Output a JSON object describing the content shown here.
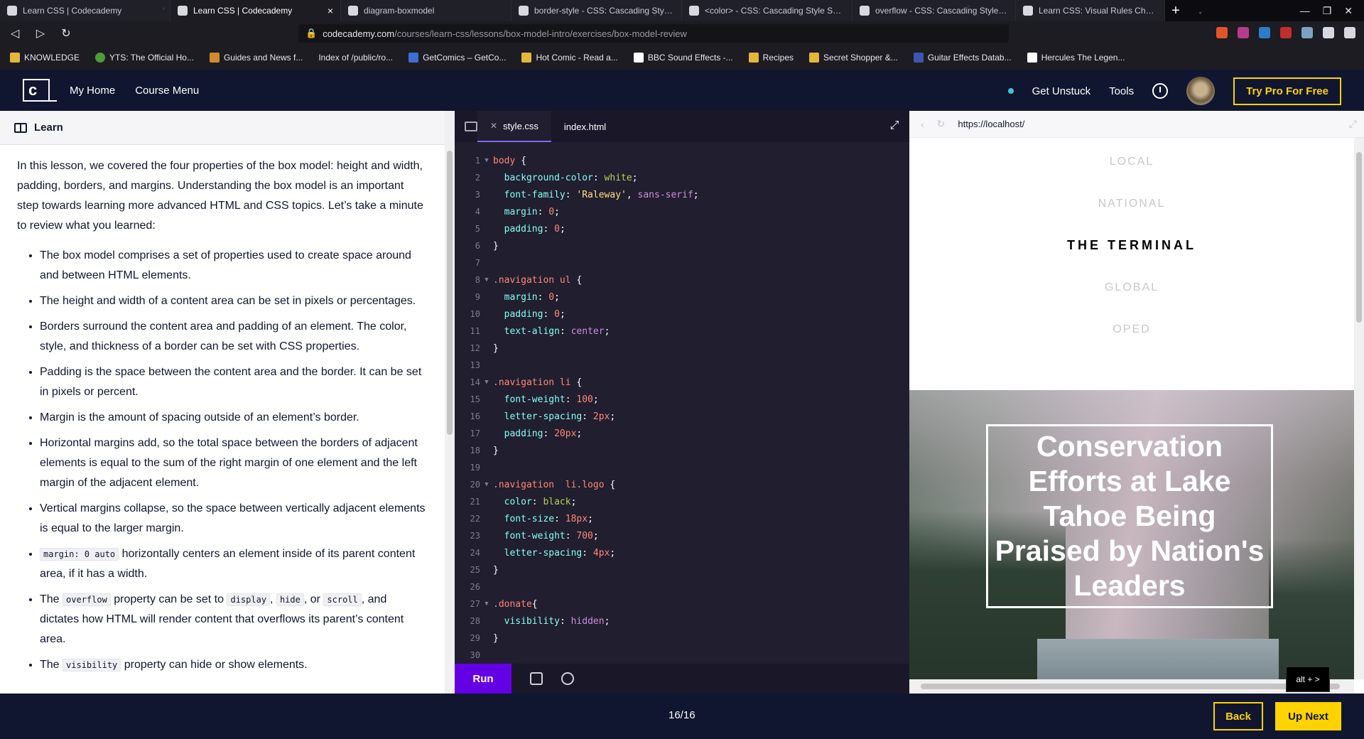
{
  "browser": {
    "tabs": [
      {
        "label": "Learn CSS | Codecademy",
        "active": false
      },
      {
        "label": "Learn CSS | Codecademy",
        "active": true
      },
      {
        "label": "diagram-boxmodel",
        "active": false
      },
      {
        "label": "border-style - CSS: Cascading Style S",
        "active": false
      },
      {
        "label": "<color> - CSS: Cascading Style Shee",
        "active": false
      },
      {
        "label": "overflow - CSS: Cascading Style Shee",
        "active": false
      },
      {
        "label": "Learn CSS: Visual Rules Cheatsheet",
        "active": false
      }
    ],
    "url_host": "codecademy.com",
    "url_path": "/courses/learn-css/lessons/box-model-intro/exercises/box-model-review",
    "bookmarks": [
      "KNOWLEDGE",
      "YTS: The Official Ho...",
      "Guides and News f...",
      "Index of /public/ro...",
      "GetComics – GetCo...",
      "Hot Comic - Read a...",
      "BBC Sound Effects -...",
      "Recipes",
      "Secret Shopper &...",
      "Guitar Effects Datab...",
      "Hercules The Legen..."
    ]
  },
  "header": {
    "logo": "c",
    "my_home": "My Home",
    "course_menu": "Course Menu",
    "get_unstuck": "Get Unstuck",
    "tools": "Tools",
    "try_pro": "Try Pro For Free"
  },
  "learn": {
    "title": "Learn",
    "intro": "In this lesson, we covered the four properties of the box model: height and width, padding, borders, and margins. Understanding the box model is an important step towards learning more advanced HTML and CSS topics. Let’s take a minute to review what you learned:",
    "bullets": [
      "The box model comprises a set of properties used to create space around and between HTML elements.",
      "The height and width of a content area can be set in pixels or percentages.",
      "Borders surround the content area and padding of an element. The color, style, and thickness of a border can be set with CSS properties.",
      "Padding is the space between the content area and the border. It can be set in pixels or percent.",
      "Margin is the amount of spacing outside of an element’s border.",
      "Horizontal margins add, so the total space between the borders of adjacent elements is equal to the sum of the right margin of one element and the left margin of the adjacent element.",
      "Vertical margins collapse, so the space between vertically adjacent elements is equal to the larger margin."
    ],
    "b8_code": "margin: 0 auto",
    "b8_text": " horizontally centers an element inside of its parent content area, if it has a width.",
    "b9_pre": "The ",
    "b9_code1": "overflow",
    "b9_mid1": " property can be set to ",
    "b9_code2": "display",
    "b9_mid2": ", ",
    "b9_code3": "hide",
    "b9_mid3": ", or ",
    "b9_code4": "scroll",
    "b9_post": ", and dictates how HTML will render content that overflows its parent’s content area.",
    "b10_pre": "The ",
    "b10_code": "visibility",
    "b10_post": " property can hide or show elements."
  },
  "editor": {
    "tabs": [
      "style.css",
      "index.html"
    ],
    "run": "Run",
    "lines": [
      {
        "n": "1",
        "fold": true,
        "parts": [
          [
            "sel",
            "body"
          ],
          [
            "txt",
            " {"
          ]
        ]
      },
      {
        "n": "2",
        "fold": false,
        "parts": [
          [
            "txt",
            "  "
          ],
          [
            "prop",
            "background-color"
          ],
          [
            "txt",
            ": "
          ],
          [
            "val",
            "white"
          ],
          [
            "txt",
            ";"
          ]
        ]
      },
      {
        "n": "3",
        "fold": false,
        "parts": [
          [
            "txt",
            "  "
          ],
          [
            "prop",
            "font-family"
          ],
          [
            "txt",
            ": "
          ],
          [
            "str",
            "'Raleway'"
          ],
          [
            "txt",
            ", "
          ],
          [
            "kw",
            "sans-serif"
          ],
          [
            "txt",
            ";"
          ]
        ]
      },
      {
        "n": "4",
        "fold": false,
        "parts": [
          [
            "txt",
            "  "
          ],
          [
            "prop",
            "margin"
          ],
          [
            "txt",
            ": "
          ],
          [
            "num",
            "0"
          ],
          [
            "txt",
            ";"
          ]
        ]
      },
      {
        "n": "5",
        "fold": false,
        "parts": [
          [
            "txt",
            "  "
          ],
          [
            "prop",
            "padding"
          ],
          [
            "txt",
            ": "
          ],
          [
            "num",
            "0"
          ],
          [
            "txt",
            ";"
          ]
        ]
      },
      {
        "n": "6",
        "fold": false,
        "parts": [
          [
            "txt",
            "}"
          ]
        ]
      },
      {
        "n": "7",
        "fold": false,
        "parts": []
      },
      {
        "n": "8",
        "fold": true,
        "parts": [
          [
            "sel",
            ".navigation"
          ],
          [
            "txt",
            " "
          ],
          [
            "sel",
            "ul"
          ],
          [
            "txt",
            " {"
          ]
        ]
      },
      {
        "n": "9",
        "fold": false,
        "parts": [
          [
            "txt",
            "  "
          ],
          [
            "prop",
            "margin"
          ],
          [
            "txt",
            ": "
          ],
          [
            "num",
            "0"
          ],
          [
            "txt",
            ";"
          ]
        ]
      },
      {
        "n": "10",
        "fold": false,
        "parts": [
          [
            "txt",
            "  "
          ],
          [
            "prop",
            "padding"
          ],
          [
            "txt",
            ": "
          ],
          [
            "num",
            "0"
          ],
          [
            "txt",
            ";"
          ]
        ]
      },
      {
        "n": "11",
        "fold": false,
        "parts": [
          [
            "txt",
            "  "
          ],
          [
            "prop",
            "text-align"
          ],
          [
            "txt",
            ": "
          ],
          [
            "kw",
            "center"
          ],
          [
            "txt",
            ";"
          ]
        ]
      },
      {
        "n": "12",
        "fold": false,
        "parts": [
          [
            "txt",
            "}"
          ]
        ]
      },
      {
        "n": "13",
        "fold": false,
        "parts": []
      },
      {
        "n": "14",
        "fold": true,
        "parts": [
          [
            "sel",
            ".navigation"
          ],
          [
            "txt",
            " "
          ],
          [
            "sel",
            "li"
          ],
          [
            "txt",
            " {"
          ]
        ]
      },
      {
        "n": "15",
        "fold": false,
        "parts": [
          [
            "txt",
            "  "
          ],
          [
            "prop",
            "font-weight"
          ],
          [
            "txt",
            ": "
          ],
          [
            "num",
            "100"
          ],
          [
            "txt",
            ";"
          ]
        ]
      },
      {
        "n": "16",
        "fold": false,
        "parts": [
          [
            "txt",
            "  "
          ],
          [
            "prop",
            "letter-spacing"
          ],
          [
            "txt",
            ": "
          ],
          [
            "num",
            "2px"
          ],
          [
            "txt",
            ";"
          ]
        ]
      },
      {
        "n": "17",
        "fold": false,
        "parts": [
          [
            "txt",
            "  "
          ],
          [
            "prop",
            "padding"
          ],
          [
            "txt",
            ": "
          ],
          [
            "num",
            "20px"
          ],
          [
            "txt",
            ";"
          ]
        ]
      },
      {
        "n": "18",
        "fold": false,
        "parts": [
          [
            "txt",
            "}"
          ]
        ]
      },
      {
        "n": "19",
        "fold": false,
        "parts": []
      },
      {
        "n": "20",
        "fold": true,
        "parts": [
          [
            "sel",
            ".navigation"
          ],
          [
            "txt",
            "  "
          ],
          [
            "sel",
            "li.logo"
          ],
          [
            "txt",
            " {"
          ]
        ]
      },
      {
        "n": "21",
        "fold": false,
        "parts": [
          [
            "txt",
            "  "
          ],
          [
            "prop",
            "color"
          ],
          [
            "txt",
            ": "
          ],
          [
            "val",
            "black"
          ],
          [
            "txt",
            ";"
          ]
        ]
      },
      {
        "n": "22",
        "fold": false,
        "parts": [
          [
            "txt",
            "  "
          ],
          [
            "prop",
            "font-size"
          ],
          [
            "txt",
            ": "
          ],
          [
            "num",
            "18px"
          ],
          [
            "txt",
            ";"
          ]
        ]
      },
      {
        "n": "23",
        "fold": false,
        "parts": [
          [
            "txt",
            "  "
          ],
          [
            "prop",
            "font-weight"
          ],
          [
            "txt",
            ": "
          ],
          [
            "num",
            "700"
          ],
          [
            "txt",
            ";"
          ]
        ]
      },
      {
        "n": "24",
        "fold": false,
        "parts": [
          [
            "txt",
            "  "
          ],
          [
            "prop",
            "letter-spacing"
          ],
          [
            "txt",
            ": "
          ],
          [
            "num",
            "4px"
          ],
          [
            "txt",
            ";"
          ]
        ]
      },
      {
        "n": "25",
        "fold": false,
        "parts": [
          [
            "txt",
            "}"
          ]
        ]
      },
      {
        "n": "26",
        "fold": false,
        "parts": []
      },
      {
        "n": "27",
        "fold": true,
        "parts": [
          [
            "sel",
            ".donate"
          ],
          [
            "txt",
            "{"
          ]
        ]
      },
      {
        "n": "28",
        "fold": false,
        "parts": [
          [
            "txt",
            "  "
          ],
          [
            "prop",
            "visibility"
          ],
          [
            "txt",
            ": "
          ],
          [
            "kw",
            "hidden"
          ],
          [
            "txt",
            ";"
          ]
        ]
      },
      {
        "n": "29",
        "fold": false,
        "parts": [
          [
            "txt",
            "}"
          ]
        ]
      },
      {
        "n": "30",
        "fold": false,
        "parts": []
      }
    ]
  },
  "preview": {
    "url": "https://localhost/",
    "nav": [
      "LOCAL",
      "NATIONAL",
      "THE TERMINAL",
      "GLOBAL",
      "OPED"
    ],
    "headline": "Conservation Efforts at Lake Tahoe Being Praised by Nation's Leaders"
  },
  "footer": {
    "progress": "16/16",
    "back": "Back",
    "next": "Up Next",
    "tooltip": "alt + >"
  },
  "colors": {
    "brand_dark": "#10162f",
    "accent_yellow": "#ffd300",
    "run_purple": "#6400e4"
  }
}
